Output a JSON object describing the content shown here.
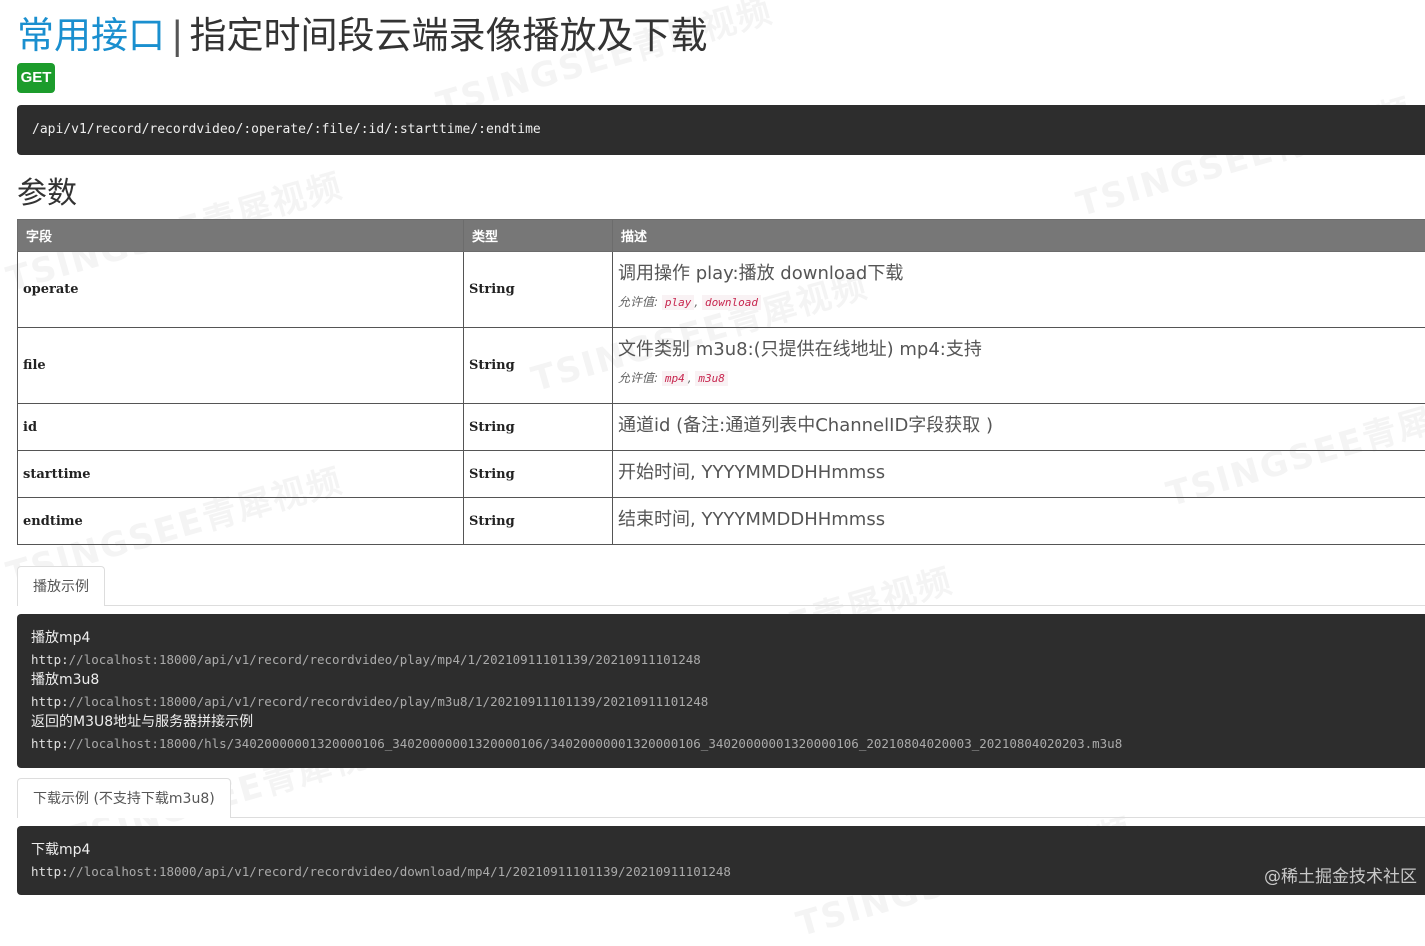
{
  "header": {
    "group": "常用接口",
    "separator": "|",
    "name": "指定时间段云端录像播放及下载",
    "method": "GET",
    "endpoint": "/api/v1/record/recordvideo/:operate/:file/:id/:starttime/:endtime"
  },
  "params": {
    "section_title": "参数",
    "columns": [
      "字段",
      "类型",
      "描述"
    ],
    "allowed_label": "允许值:",
    "rows": [
      {
        "field": "operate",
        "type": "String",
        "desc": "调用操作 play:播放 download下载",
        "allowed": [
          "play",
          "download"
        ]
      },
      {
        "field": "file",
        "type": "String",
        "desc": "文件类别 m3u8:(只提供在线地址) mp4:支持",
        "allowed": [
          "mp4",
          "m3u8"
        ]
      },
      {
        "field": "id",
        "type": "String",
        "desc": "通道id (备注:通道列表中ChannelID字段获取 )"
      },
      {
        "field": "starttime",
        "type": "String",
        "desc": "开始时间, YYYYMMDDHHmmss"
      },
      {
        "field": "endtime",
        "type": "String",
        "desc": "结束时间, YYYYMMDDHHmmss"
      }
    ]
  },
  "play_example": {
    "tab": "播放示例",
    "lines": [
      {
        "kind": "label",
        "text": "播放mp4"
      },
      {
        "kind": "url",
        "proto": "http:",
        "rest": "//localhost:18000/api/v1/record/recordvideo/play/mp4/1/20210911101139/20210911101248"
      },
      {
        "kind": "label",
        "text": "播放m3u8"
      },
      {
        "kind": "url",
        "proto": "http:",
        "rest": "//localhost:18000/api/v1/record/recordvideo/play/m3u8/1/20210911101139/20210911101248"
      },
      {
        "kind": "label",
        "text": "返回的M3U8地址与服务器拼接示例"
      },
      {
        "kind": "url",
        "proto": "http:",
        "rest": "//localhost:18000/hls/34020000001320000106_34020000001320000106/34020000001320000106_34020000001320000106_20210804020003_20210804020203.m3u8"
      }
    ]
  },
  "download_example": {
    "tab": "下载示例 (不支持下载m3u8)",
    "lines": [
      {
        "kind": "label",
        "text": "下载mp4"
      },
      {
        "kind": "url",
        "proto": "http:",
        "rest": "//localhost:18000/api/v1/record/recordvideo/download/mp4/1/20210911101139/20210911101248"
      }
    ]
  },
  "watermark_text": "TSINGSEE青犀视频",
  "credit": "@稀土掘金技术社区"
}
